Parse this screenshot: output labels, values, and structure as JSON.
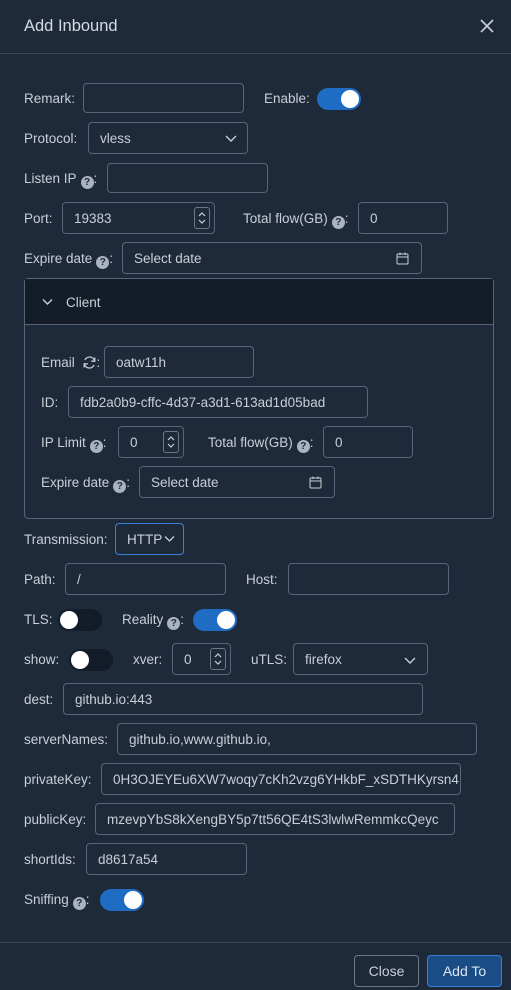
{
  "dialog": {
    "title": "Add Inbound"
  },
  "form": {
    "remark_label": "Remark:",
    "remark_value": "",
    "enable_label": "Enable:",
    "enable_on": true,
    "protocol_label": "Protocol:",
    "protocol_value": "vless",
    "listen_ip_label": "Listen IP",
    "listen_ip_value": "",
    "port_label": "Port:",
    "port_value": "19383",
    "total_flow_label": "Total flow(GB)",
    "total_flow_value": "0",
    "expire_label": "Expire date",
    "expire_placeholder": "Select date"
  },
  "client": {
    "header_label": "Client",
    "email_label": "Email",
    "email_value": "oatw11h",
    "id_label": "ID:",
    "id_value": "fdb2a0b9-cffc-4d37-a3d1-613ad1d05bad",
    "ip_limit_label": "IP Limit",
    "ip_limit_value": "0",
    "total_flow_label": "Total flow(GB)",
    "total_flow_value": "0",
    "expire_label": "Expire date",
    "expire_placeholder": "Select date"
  },
  "transport": {
    "transmission_label": "Transmission:",
    "transmission_value": "HTTP",
    "path_label": "Path:",
    "path_value": "/",
    "host_label": "Host:",
    "host_value": ""
  },
  "security": {
    "tls_label": "TLS:",
    "tls_on": false,
    "reality_label": "Reality",
    "reality_on": true,
    "show_label": "show:",
    "show_on": false,
    "xver_label": "xver:",
    "xver_value": "0",
    "utls_label": "uTLS:",
    "utls_value": "firefox",
    "dest_label": "dest:",
    "dest_value": "github.io:443",
    "server_names_label": "serverNames:",
    "server_names_value": "github.io,www.github.io,",
    "private_key_label": "privateKey:",
    "private_key_value": "0H3OJEYEu6XW7woqy7cKh2vzg6YHkbF_xSDTHKyrsn4",
    "public_key_label": "publicKey:",
    "public_key_value": "mzevpYbS8kXengBY5p7tt56QE4tS3lwlwRemmkcQeyc",
    "short_ids_label": "shortIds:",
    "short_ids_value": "d8617a54",
    "sniffing_label": "Sniffing",
    "sniffing_on": true
  },
  "footer": {
    "close_label": "Close",
    "add_label": "Add To"
  },
  "colors": {
    "accent": "#1f6cc4",
    "background": "#1e2a3a",
    "border": "#55657a"
  },
  "icons": {
    "help": "question-circle-icon",
    "calendar": "calendar-icon",
    "chevron": "chevron-down-icon",
    "refresh": "sync-icon",
    "close": "close-icon"
  }
}
